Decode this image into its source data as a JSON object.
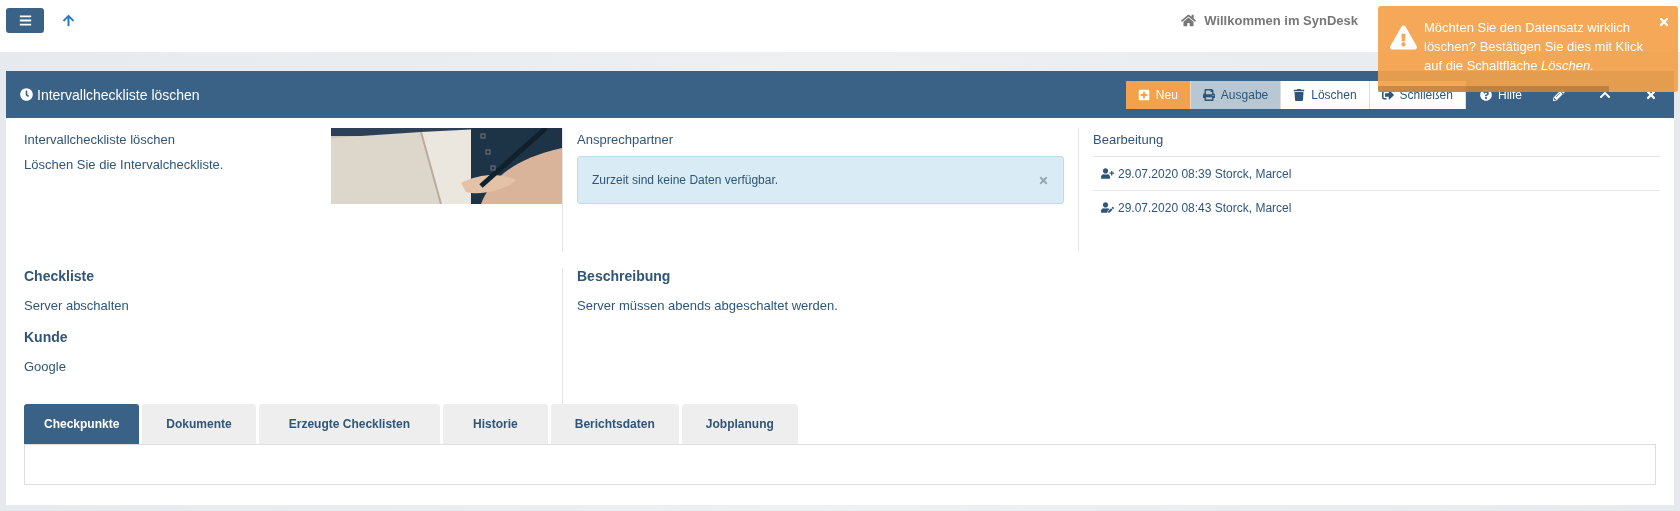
{
  "topbar": {
    "welcome": "Willkommen im SynDesk"
  },
  "toast": {
    "message": "Möchten Sie den Datensatz wirklich löschen? Bestätigen Sie dies mit Klick auf die Schaltfläche *Löschen.*",
    "level": 0.77
  },
  "panel": {
    "title": "Intervallcheckliste löschen",
    "toolbar": [
      {
        "kind": "new",
        "label": "Neu"
      },
      {
        "kind": "print",
        "label": "Ausgabe"
      },
      {
        "kind": "delete",
        "label": "Löschen"
      },
      {
        "kind": "exit",
        "label": "Schließen"
      },
      {
        "kind": "help",
        "label": "Hilfe"
      },
      {
        "kind": "edit"
      },
      {
        "kind": "collapse"
      },
      {
        "kind": "close"
      }
    ]
  },
  "info": {
    "heading": "Intervallcheckliste löschen",
    "text": "Löschen Sie die Intervalcheckliste."
  },
  "contact": {
    "heading": "Ansprechpartner",
    "alert": "Zurzeit sind keine Daten verfügbar."
  },
  "history": {
    "heading": "Bearbeitung",
    "entries": [
      {
        "kind": "created",
        "text": "29.07.2020 08:39 Storck, Marcel"
      },
      {
        "kind": "edited",
        "text": "29.07.2020 08:43 Storck, Marcel"
      }
    ]
  },
  "fields": [
    {
      "label": "Checkliste",
      "value": "Server abschalten"
    },
    {
      "label": "Kunde",
      "value": "Google"
    }
  ],
  "description": {
    "label": "Beschreibung",
    "value": "Server müssen abends abgeschaltet werden."
  },
  "tabs": [
    {
      "label": "Checkpunkte",
      "selected": true
    },
    {
      "label": "Dokumente",
      "selected": false
    },
    {
      "label": "Erzeugte Checklisten",
      "selected": false
    },
    {
      "label": "Historie",
      "selected": false
    },
    {
      "label": "Berichtsdaten",
      "selected": false
    },
    {
      "label": "Jobplanung",
      "selected": false
    }
  ]
}
